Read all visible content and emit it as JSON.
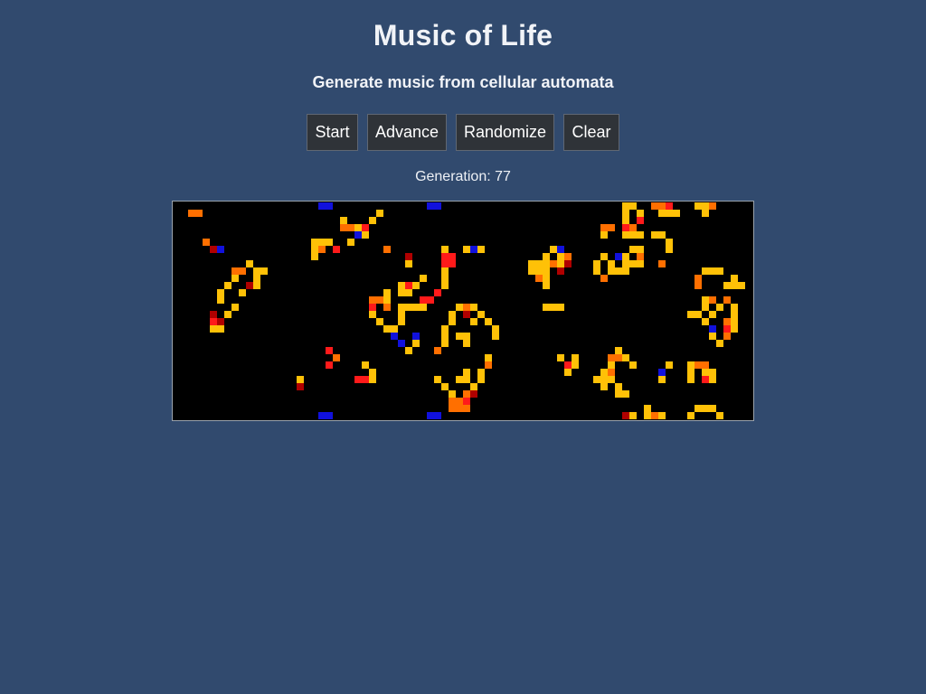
{
  "header": {
    "title": "Music of Life",
    "subtitle": "Generate music from cellular automata"
  },
  "toolbar": {
    "start_label": "Start",
    "advance_label": "Advance",
    "randomize_label": "Randomize",
    "clear_label": "Clear"
  },
  "status": {
    "generation_text": "Generation: 77"
  },
  "colors": {
    "page_background": "#314a6e",
    "board_background": "#000000",
    "button_background": "#2f3338",
    "button_border": "#5f6773",
    "cell_yellow": "#ffc107",
    "cell_orange": "#ff6f00",
    "cell_red": "#ff1a1a",
    "cell_darkred": "#b00000",
    "cell_blue": "#1111dd"
  }
}
